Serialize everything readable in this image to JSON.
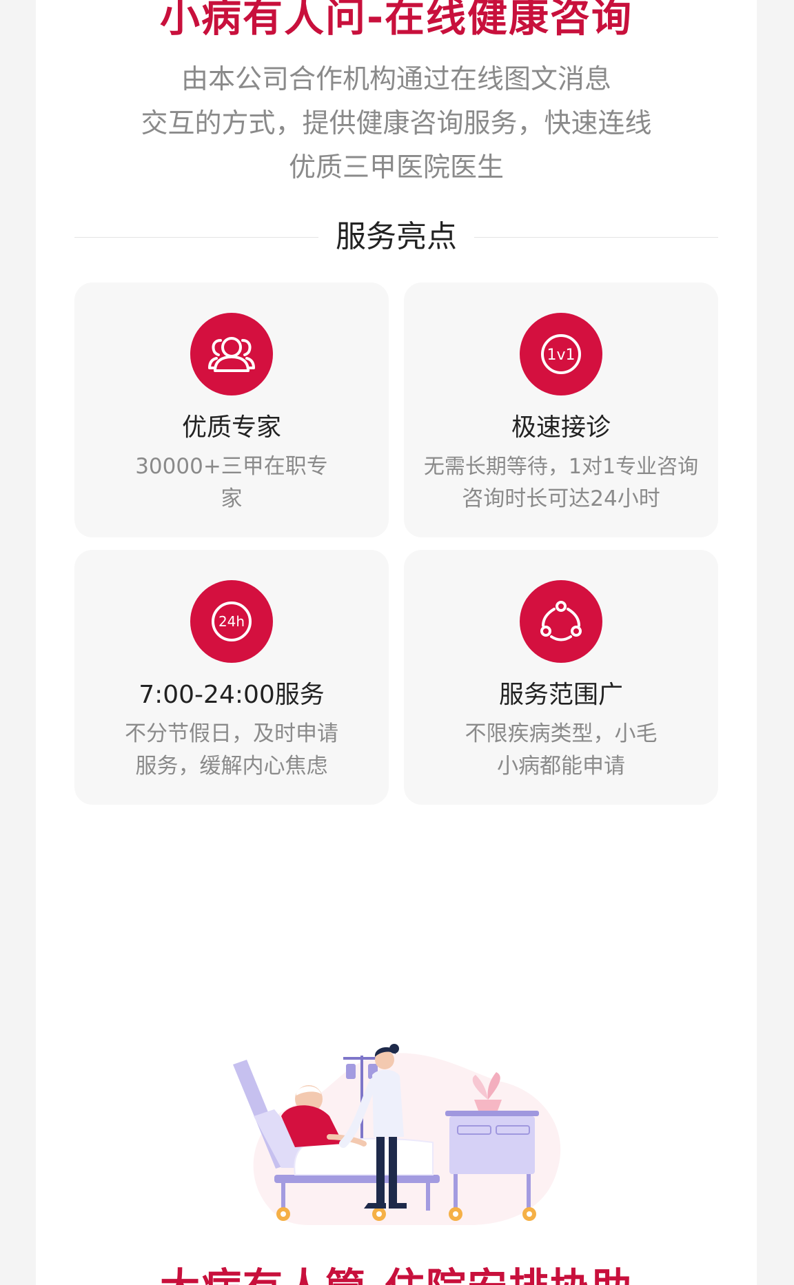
{
  "header": {
    "title": "小病有人问-在线健康咨询",
    "intro_lines": [
      "由本公司合作机构通过在线图文消息",
      "交互的方式，提供健康咨询服务，快速连线",
      "优质三甲医院医生"
    ]
  },
  "highlights": {
    "heading": "服务亮点",
    "cards": [
      {
        "icon": "experts-icon",
        "title": "优质专家",
        "desc_lines": [
          "30000+三甲在职专",
          "家"
        ]
      },
      {
        "icon": "one-on-one-icon",
        "icon_text": "1v1",
        "title": "极速接诊",
        "desc_lines": [
          "无需长期等待，1对1专业咨询",
          "咨询时长可达24小时"
        ]
      },
      {
        "icon": "24h-icon",
        "icon_text": "24h",
        "title": "7:00-24:00服务",
        "desc_lines": [
          "不分节假日，及时申请",
          "服务，缓解内心焦虑"
        ]
      },
      {
        "icon": "coverage-icon",
        "title": "服务范围广",
        "desc_lines": [
          "不限疾病类型，小毛",
          "小病都能申请"
        ]
      }
    ]
  },
  "next_section": {
    "title": "大病有人管-住院安排协助"
  },
  "colors": {
    "accent": "#c8103c",
    "icon_bg": "#d4103f",
    "card_bg": "#f7f7f7",
    "muted_text": "#8a8a8a",
    "bed_purple": "#b9b1e8"
  }
}
